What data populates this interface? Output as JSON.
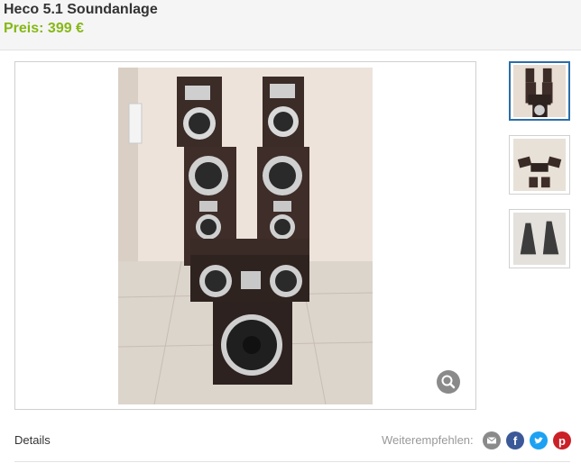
{
  "listing": {
    "title": "Heco 5.1 Soundanlage",
    "price": "Preis: 399 €"
  },
  "gallery": {
    "zoom_icon": "magnifier-icon",
    "thumbnails": [
      {
        "label": "speakers-set",
        "active": true
      },
      {
        "label": "speakers-flat",
        "active": false
      },
      {
        "label": "wall-brackets",
        "active": false
      }
    ]
  },
  "footer": {
    "details_label": "Details",
    "share_label": "Weiterempfehlen:",
    "share_icons": [
      "email-icon",
      "facebook-icon",
      "twitter-icon",
      "pinterest-icon"
    ]
  },
  "colors": {
    "price": "#86b817",
    "thumb_active_border": "#2b6ea8",
    "email": "#8a8a8a",
    "facebook": "#3b5998",
    "twitter": "#1da1f2",
    "pinterest": "#cb2027"
  }
}
